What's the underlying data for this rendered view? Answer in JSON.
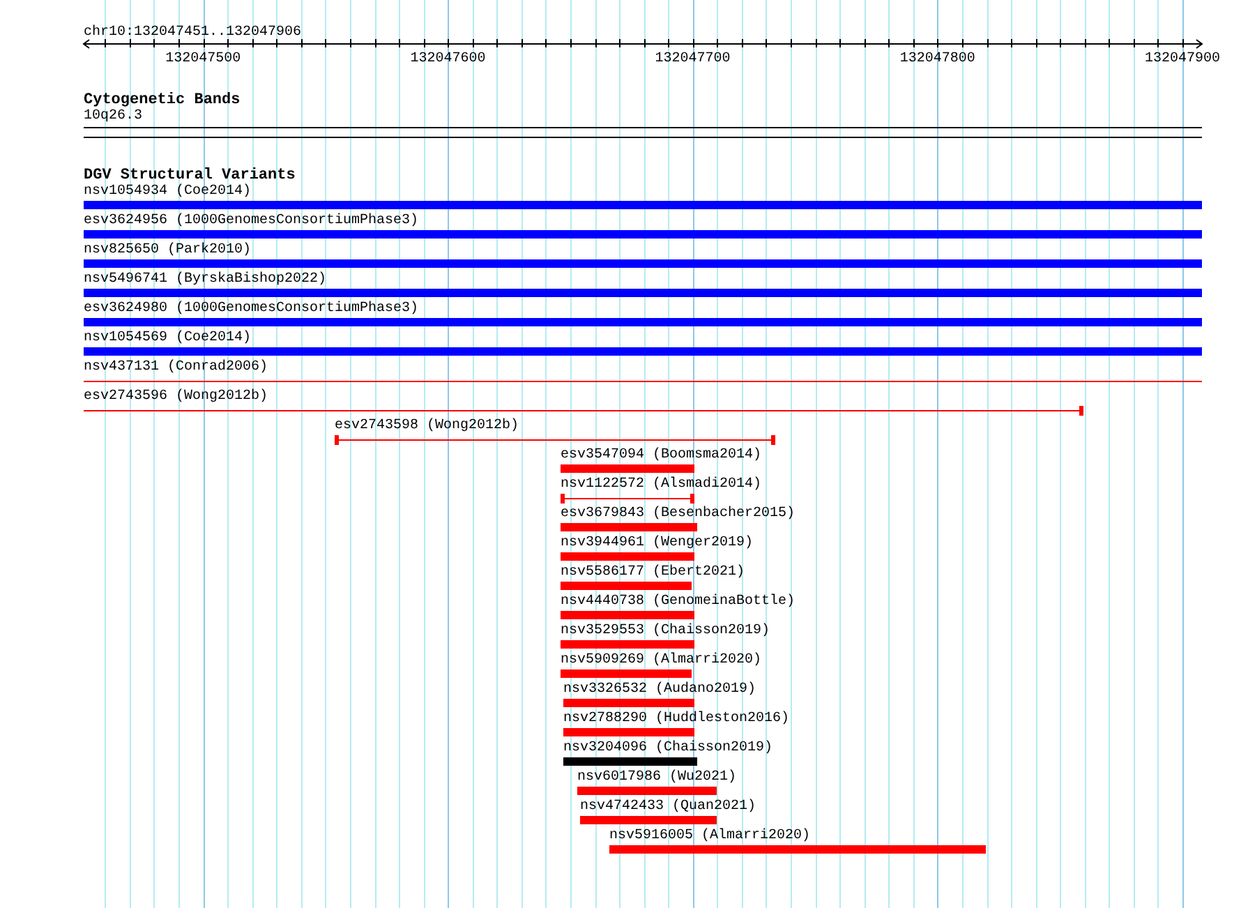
{
  "ruler": {
    "location": "chr10:132047451..132047906",
    "tick_labels": [
      "132047500",
      "132047600",
      "132047700",
      "132047800",
      "132047900"
    ]
  },
  "cytogenetic_bands": {
    "title": "Cytogenetic Bands",
    "band": "10q26.3"
  },
  "dgv": {
    "title": "DGV Structural Variants",
    "variants": [
      {
        "label": "nsv1054934 (Coe2014)",
        "kind": "bar",
        "color": "#0000ff"
      },
      {
        "label": "esv3624956 (1000GenomesConsortiumPhase3)",
        "kind": "bar",
        "color": "#0000ff"
      },
      {
        "label": "nsv825650 (Park2010)",
        "kind": "bar",
        "color": "#0000ff"
      },
      {
        "label": "nsv5496741 (ByrskaBishop2022)",
        "kind": "bar",
        "color": "#0000ff"
      },
      {
        "label": "esv3624980 (1000GenomesConsortiumPhase3)",
        "kind": "bar",
        "color": "#0000ff"
      },
      {
        "label": "nsv1054569 (Coe2014)",
        "kind": "bar",
        "color": "#0000ff"
      },
      {
        "label": "nsv437131 (Conrad2006)",
        "kind": "span",
        "color": "#ff0000"
      },
      {
        "label": "esv2743596 (Wong2012b)",
        "kind": "span",
        "color": "#ff0000"
      },
      {
        "label": "esv2743598 (Wong2012b)",
        "kind": "span",
        "color": "#ff0000"
      },
      {
        "label": "esv3547094 (Boomsma2014)",
        "kind": "bar",
        "color": "#ff0000"
      },
      {
        "label": "nsv1122572 (Alsmadi2014)",
        "kind": "span",
        "color": "#ff0000"
      },
      {
        "label": "esv3679843 (Besenbacher2015)",
        "kind": "bar",
        "color": "#ff0000"
      },
      {
        "label": "nsv3944961 (Wenger2019)",
        "kind": "bar",
        "color": "#ff0000"
      },
      {
        "label": "nsv5586177 (Ebert2021)",
        "kind": "bar",
        "color": "#ff0000"
      },
      {
        "label": "nsv4440738 (GenomeinaBottle)",
        "kind": "bar",
        "color": "#ff0000"
      },
      {
        "label": "nsv3529553 (Chaisson2019)",
        "kind": "bar",
        "color": "#ff0000"
      },
      {
        "label": "nsv5909269 (Almarri2020)",
        "kind": "bar",
        "color": "#ff0000"
      },
      {
        "label": "nsv3326532 (Audano2019)",
        "kind": "bar",
        "color": "#ff0000"
      },
      {
        "label": "nsv2788290 (Huddleston2016)",
        "kind": "bar",
        "color": "#ff0000"
      },
      {
        "label": "nsv3204096 (Chaisson2019)",
        "kind": "bar",
        "color": "#000000"
      },
      {
        "label": "nsv6017986 (Wu2021)",
        "kind": "bar",
        "color": "#ff0000"
      },
      {
        "label": "nsv4742433 (Quan2021)",
        "kind": "bar",
        "color": "#ff0000"
      },
      {
        "label": "nsv5916005 (Almarri2020)",
        "kind": "bar",
        "color": "#ff0000"
      }
    ]
  }
}
